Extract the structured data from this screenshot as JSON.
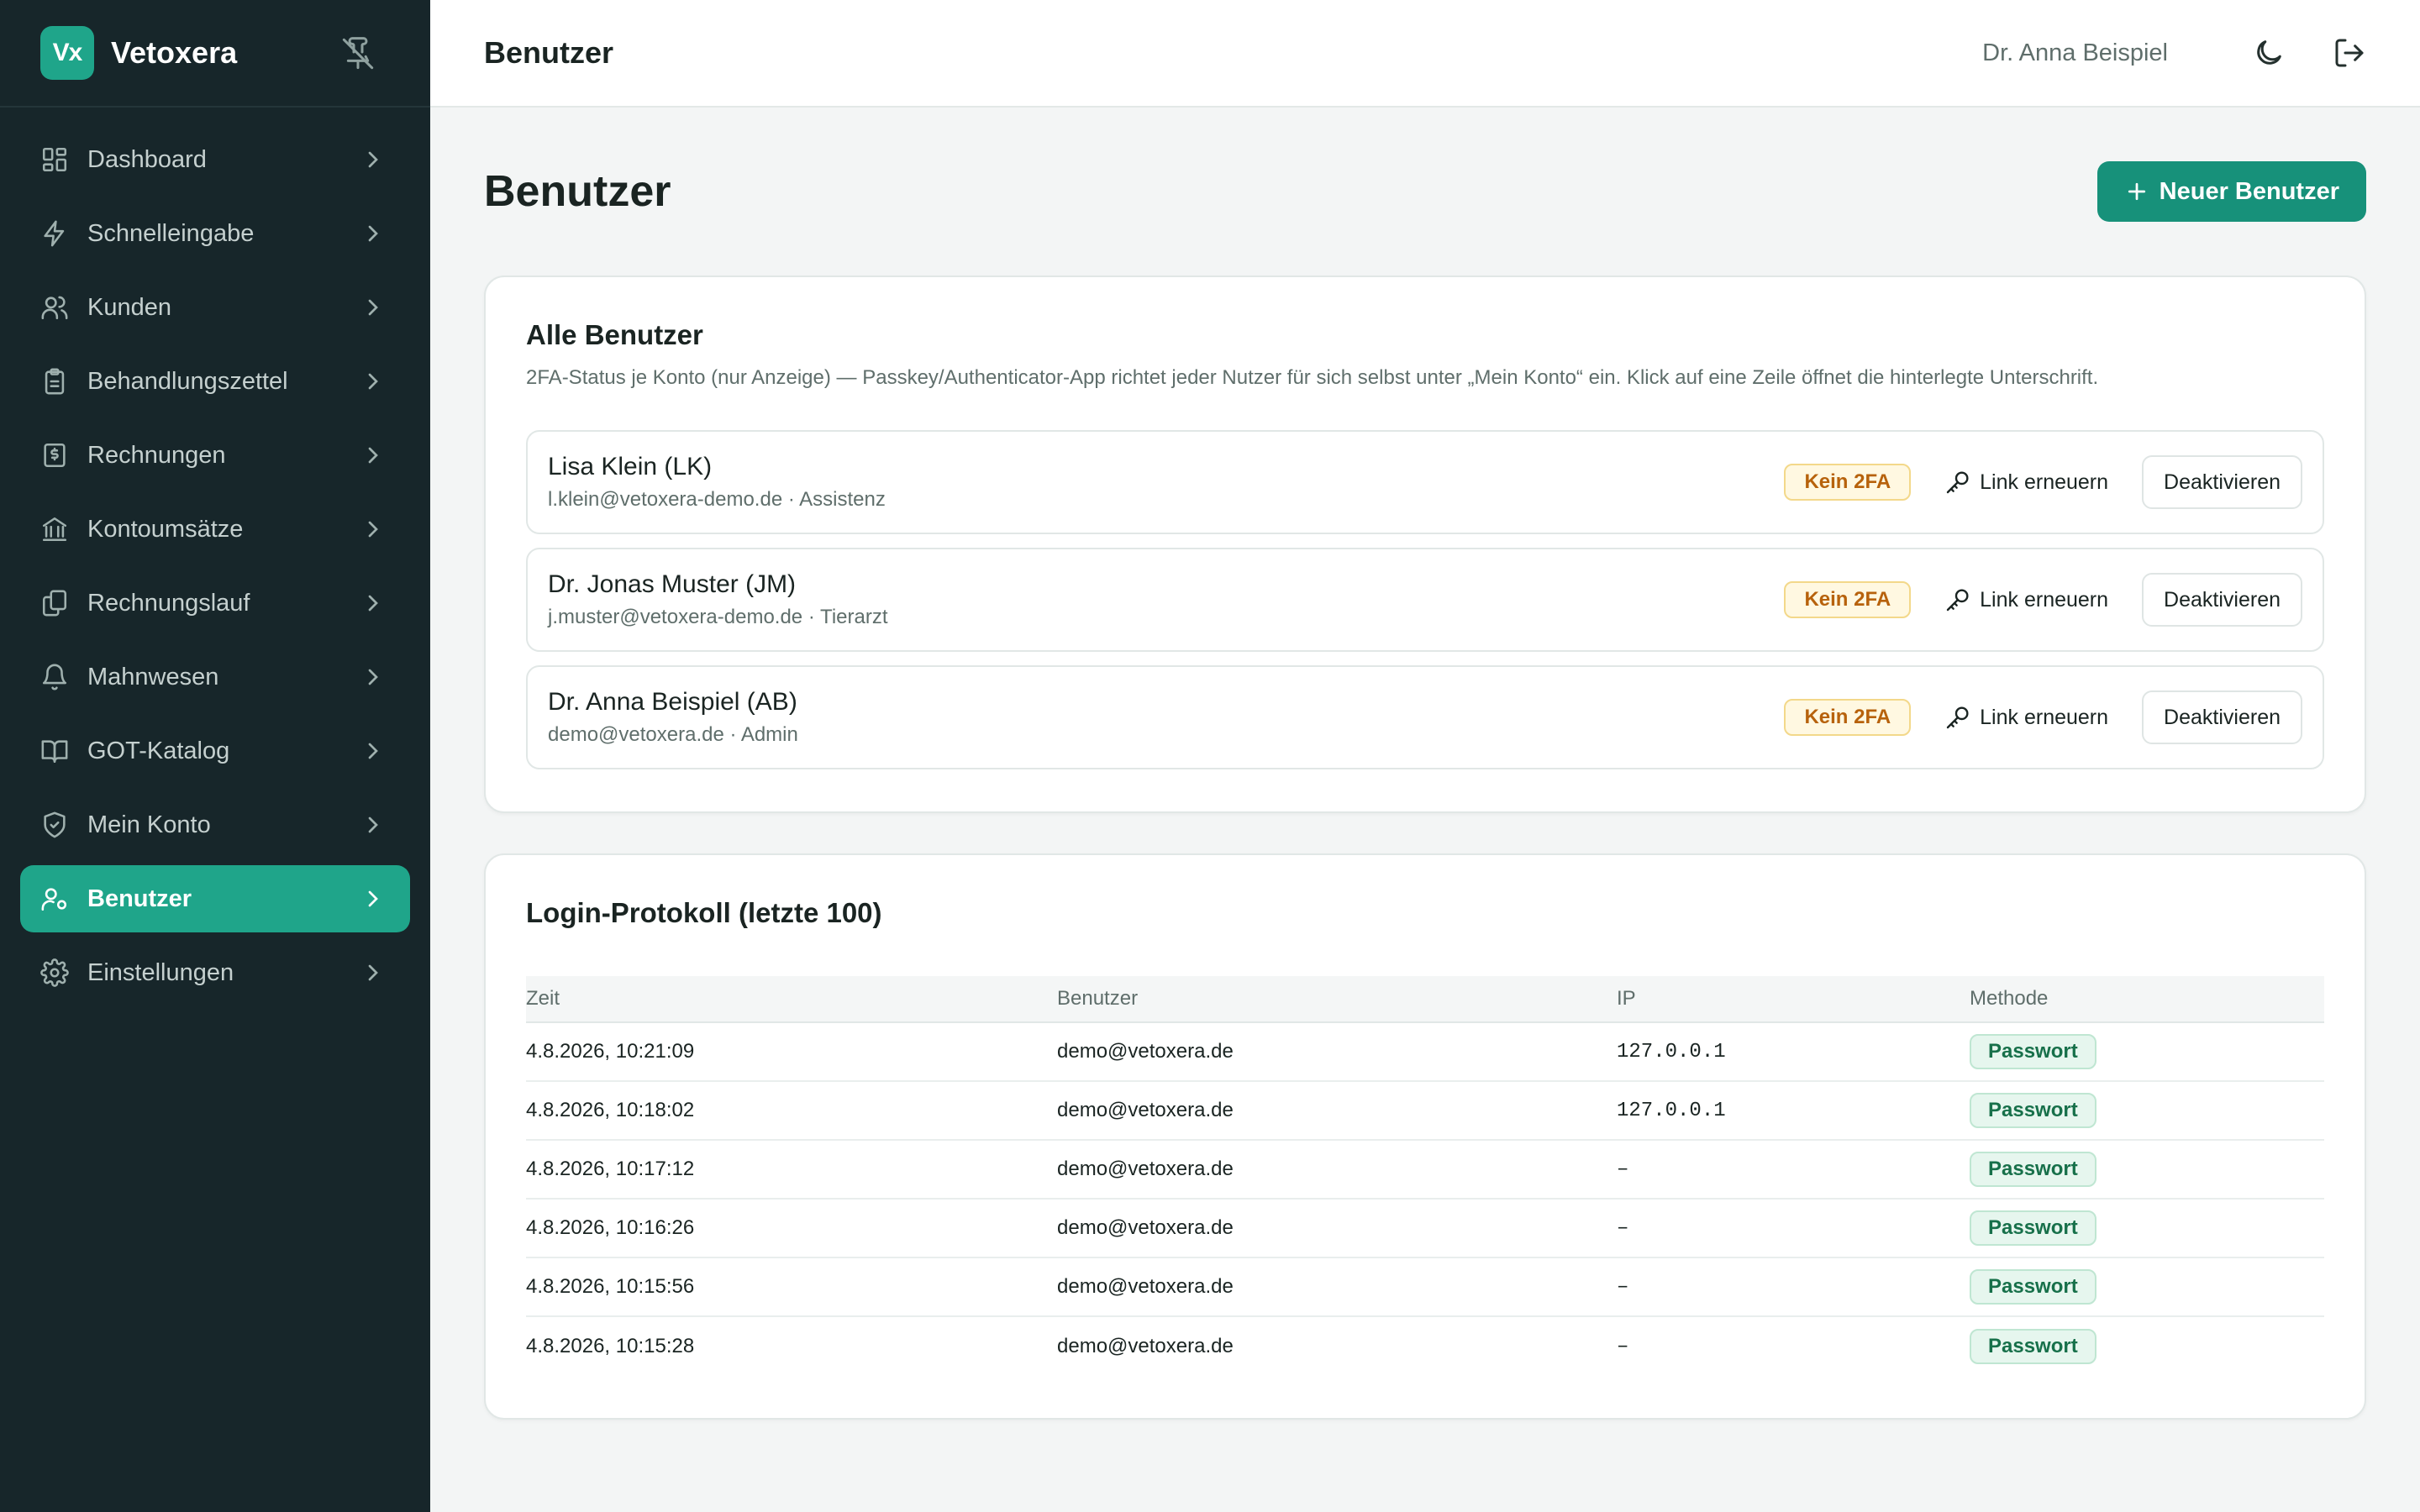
{
  "brand": {
    "logo_text": "Vx",
    "name": "Vetoxera"
  },
  "sidebar": {
    "items": [
      {
        "label": "Dashboard",
        "icon": "dashboard-icon"
      },
      {
        "label": "Schnelleingabe",
        "icon": "bolt-icon"
      },
      {
        "label": "Kunden",
        "icon": "users-icon"
      },
      {
        "label": "Behandlungszettel",
        "icon": "clipboard-icon"
      },
      {
        "label": "Rechnungen",
        "icon": "invoice-icon"
      },
      {
        "label": "Kontoumsätze",
        "icon": "bank-icon"
      },
      {
        "label": "Rechnungslauf",
        "icon": "files-icon"
      },
      {
        "label": "Mahnwesen",
        "icon": "bell-icon"
      },
      {
        "label": "GOT-Katalog",
        "icon": "book-icon"
      },
      {
        "label": "Mein Konto",
        "icon": "shield-icon"
      },
      {
        "label": "Benutzer",
        "icon": "user-cog-icon",
        "active": true
      },
      {
        "label": "Einstellungen",
        "icon": "gear-icon"
      }
    ]
  },
  "header": {
    "title": "Benutzer",
    "user_name": "Dr. Anna Beispiel"
  },
  "page": {
    "title": "Benutzer",
    "new_user_label": "Neuer Benutzer"
  },
  "users_card": {
    "title": "Alle Benutzer",
    "subtitle": "2FA-Status je Konto (nur Anzeige) — Passkey/Authenticator-App richtet jeder Nutzer für sich selbst unter „Mein Konto“ ein. Klick auf eine Zeile öffnet die hinterlegte Unterschrift.",
    "users": [
      {
        "name": "Lisa Klein (LK)",
        "meta": "l.klein@vetoxera-demo.de · Assistenz",
        "badge": "Kein 2FA",
        "link_label": "Link erneuern",
        "deactivate_label": "Deaktivieren"
      },
      {
        "name": "Dr. Jonas Muster (JM)",
        "meta": "j.muster@vetoxera-demo.de · Tierarzt",
        "badge": "Kein 2FA",
        "link_label": "Link erneuern",
        "deactivate_label": "Deaktivieren"
      },
      {
        "name": "Dr. Anna Beispiel (AB)",
        "meta": "demo@vetoxera.de · Admin",
        "badge": "Kein 2FA",
        "link_label": "Link erneuern",
        "deactivate_label": "Deaktivieren"
      }
    ]
  },
  "login_log": {
    "title": "Login-Protokoll (letzte 100)",
    "columns": [
      "Zeit",
      "Benutzer",
      "IP",
      "Methode"
    ],
    "rows": [
      {
        "time": "4.8.2026, 10:21:09",
        "user": "demo@vetoxera.de",
        "ip": "127.0.0.1",
        "method": "Passwort"
      },
      {
        "time": "4.8.2026, 10:18:02",
        "user": "demo@vetoxera.de",
        "ip": "127.0.0.1",
        "method": "Passwort"
      },
      {
        "time": "4.8.2026, 10:17:12",
        "user": "demo@vetoxera.de",
        "ip": "–",
        "method": "Passwort"
      },
      {
        "time": "4.8.2026, 10:16:26",
        "user": "demo@vetoxera.de",
        "ip": "–",
        "method": "Passwort"
      },
      {
        "time": "4.8.2026, 10:15:56",
        "user": "demo@vetoxera.de",
        "ip": "–",
        "method": "Passwort"
      },
      {
        "time": "4.8.2026, 10:15:28",
        "user": "demo@vetoxera.de",
        "ip": "–",
        "method": "Passwort"
      }
    ]
  },
  "colors": {
    "sidebar_bg": "#17262a",
    "accent": "#1fa58a",
    "primary_button": "#17917a",
    "warning_badge": "#b7620c",
    "success_badge": "#17704a"
  }
}
